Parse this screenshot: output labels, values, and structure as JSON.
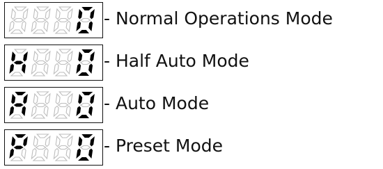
{
  "modes": [
    {
      "code": [
        "",
        "",
        "",
        "0"
      ],
      "label": "- Normal Operations Mode"
    },
    {
      "code": [
        "H",
        "",
        "",
        "0"
      ],
      "label": "- Half Auto Mode"
    },
    {
      "code": [
        "A",
        "",
        "",
        "0"
      ],
      "label": "- Auto Mode"
    },
    {
      "code": [
        "P",
        "",
        "",
        "0"
      ],
      "label": "- Preset Mode"
    }
  ],
  "colors": {
    "segment_on": "#000000",
    "segment_off": "#bdbdbd",
    "text": "#111111"
  }
}
